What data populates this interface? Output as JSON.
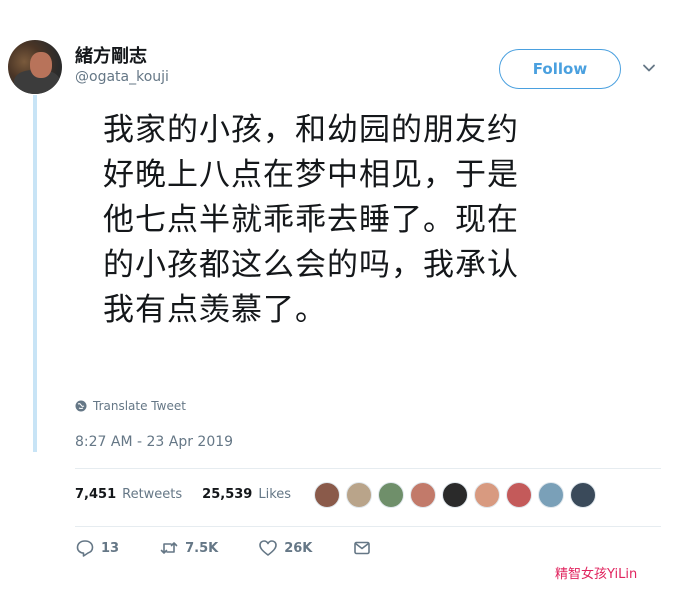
{
  "user": {
    "display_name": "緒方剛志",
    "handle": "@ogata_kouji"
  },
  "follow_button": {
    "label": "Follow"
  },
  "tweet": {
    "lines": [
      "我家的小孩，和幼园的朋友约",
      "好晚上八点在梦中相见，于是",
      "他七点半就乖乖去睡了。现在",
      "的小孩都这么会的吗，我承认",
      "我有点羡慕了。"
    ]
  },
  "translate_label": "Translate Tweet",
  "timestamp": "8:27 AM - 23 Apr 2019",
  "stats": {
    "retweets_count": "7,451",
    "retweets_label": "Retweets",
    "likes_count": "25,539",
    "likes_label": "Likes"
  },
  "likers_colors": [
    "#8a5a4a",
    "#b9a48a",
    "#6f8f6a",
    "#c27a6a",
    "#2a2a2a",
    "#d89a80",
    "#c45a5a",
    "#7aa0b8",
    "#3a4a5a"
  ],
  "actions": {
    "replies": "13",
    "retweets": "7.5K",
    "likes": "26K"
  },
  "icons": {
    "reply": "reply-icon",
    "retweet": "retweet-icon",
    "like": "heart-icon",
    "dm": "envelope-icon",
    "translate": "globe-icon",
    "caret": "chevron-down-icon"
  },
  "colors": {
    "accent": "#1da1f2",
    "follow_border": "#4aa0df",
    "thread_line": "#c8e4f6",
    "muted": "#657786",
    "watermark": "#e0245e"
  },
  "watermark": "精智女孩YiLin"
}
